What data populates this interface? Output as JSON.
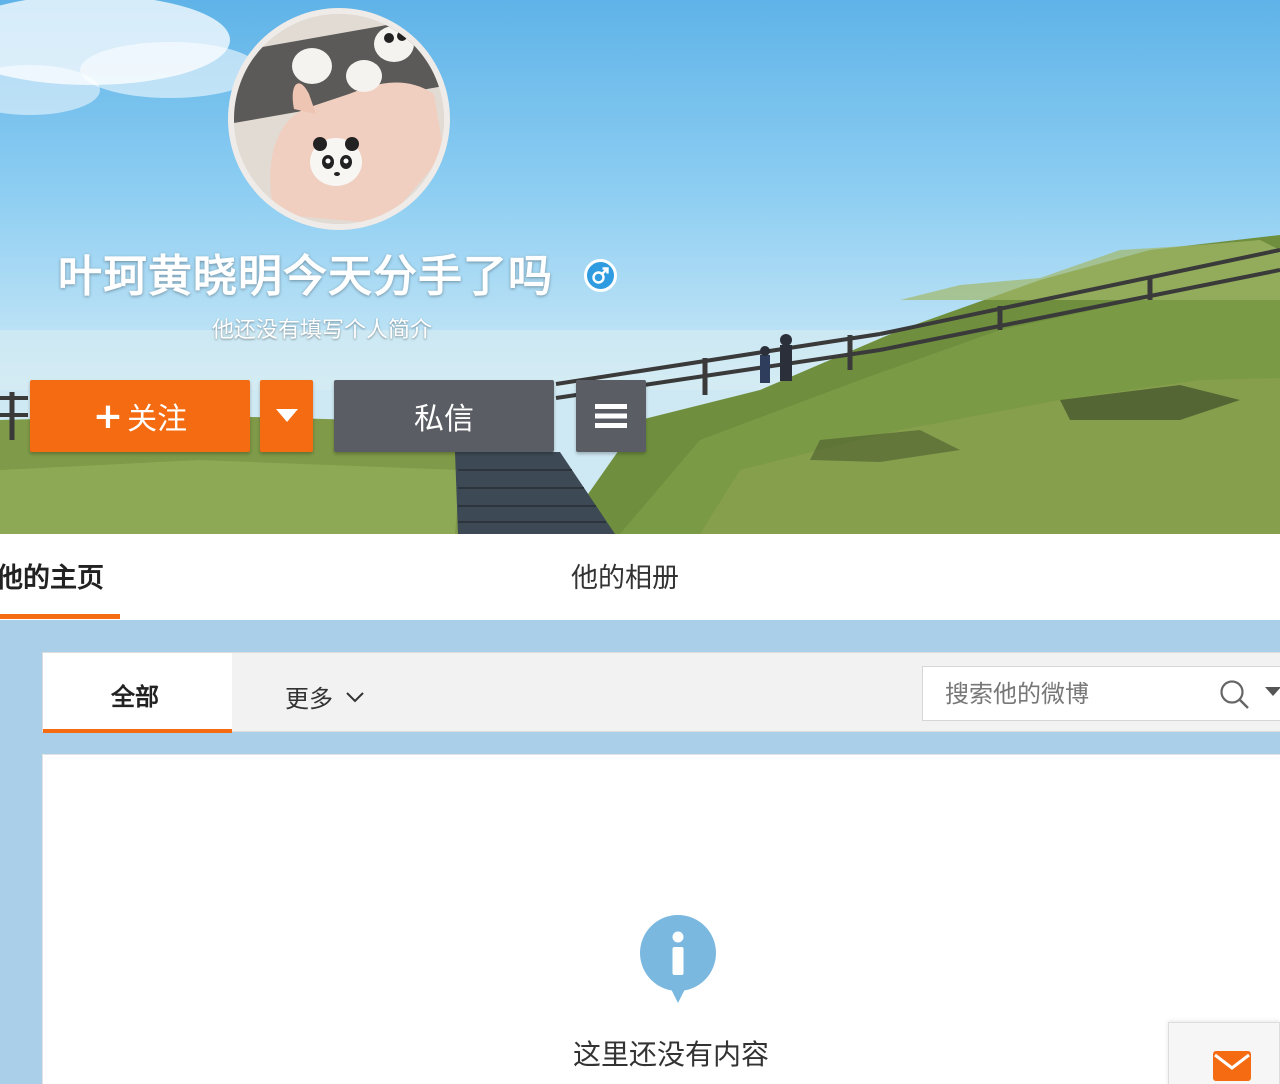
{
  "profile": {
    "username": "叶珂黄晓明今天分手了吗",
    "bio": "他还没有填写个人简介",
    "gender_icon": "male-icon"
  },
  "actions": {
    "follow_plus": "+",
    "follow_label": "关注",
    "message_label": "私信"
  },
  "tabs": {
    "home": "他的主页",
    "album": "他的相册"
  },
  "filter": {
    "all_label": "全部",
    "more_label": "更多",
    "search_placeholder": "搜索他的微博"
  },
  "empty_state": {
    "text": "这里还没有内容"
  },
  "colors": {
    "accent": "#f46b12",
    "dark_button": "#5a5d63",
    "page_bg": "#a9cfe9",
    "info_icon": "#7ab8e0"
  }
}
